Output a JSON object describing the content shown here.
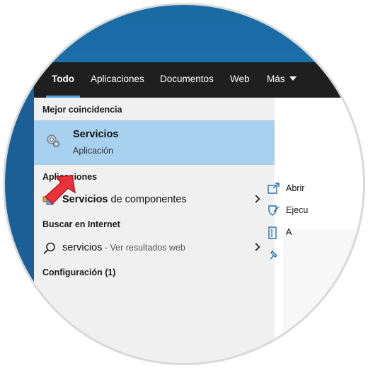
{
  "tabs": [
    {
      "label": "Todo",
      "active": true
    },
    {
      "label": "Aplicaciones"
    },
    {
      "label": "Documentos"
    },
    {
      "label": "Web"
    },
    {
      "label": "Más"
    }
  ],
  "sections": {
    "best_match": "Mejor coincidencia",
    "apps": "Aplicaciones",
    "internet": "Buscar en Internet",
    "settings": "Configuración (1)"
  },
  "best_match_item": {
    "title": "Servicios",
    "subtitle": "Aplicación",
    "icon": "gears-icon"
  },
  "app_item": {
    "bold": "Servicios",
    "rest": " de componentes",
    "icon": "component-services-icon"
  },
  "web_item": {
    "query": "servicios",
    "suffix": " - Ver resultados web",
    "icon": "search-icon"
  },
  "actions": [
    {
      "label": "Abrir",
      "icon": "open-icon"
    },
    {
      "label": "Ejecu",
      "icon": "shield-icon"
    },
    {
      "label": "A",
      "icon": "folder-icon"
    }
  ],
  "colors": {
    "tab_bar": "#1f1f1f",
    "active_tab_underline": "#4aa0e6",
    "highlight": "#a8d0ef",
    "left_pane": "#f0f0f0",
    "desktop": "#1b6fa8",
    "pointer_arrow": "#e8333a"
  }
}
